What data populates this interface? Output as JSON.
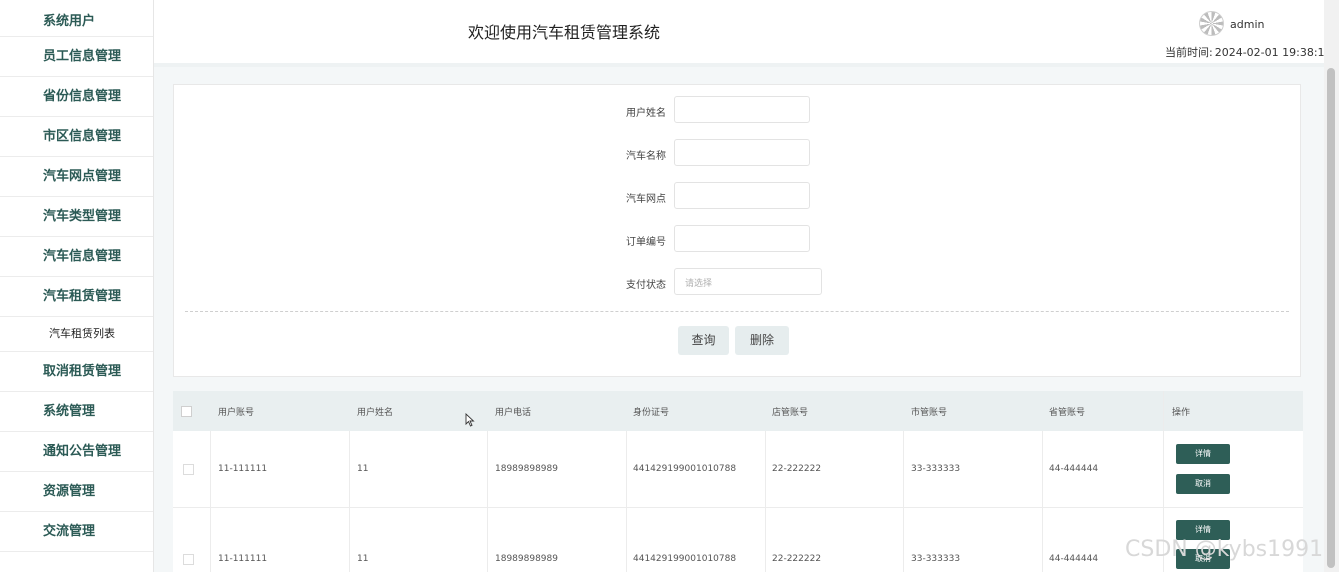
{
  "header": {
    "title": "欢迎使用汽车租赁管理系统",
    "username": "admin",
    "clock_label": "当前时间:",
    "clock_value": "2024-02-01 19:38:13"
  },
  "sidebar": {
    "items": [
      "系统用户",
      "员工信息管理",
      "省份信息管理",
      "市区信息管理",
      "汽车网点管理",
      "汽车类型管理",
      "汽车信息管理",
      "汽车租赁管理",
      "汽车租赁列表",
      "取消租赁管理",
      "系统管理",
      "通知公告管理",
      "资源管理",
      "交流管理"
    ]
  },
  "search": {
    "fields": [
      {
        "label": "用户姓名",
        "value": ""
      },
      {
        "label": "汽车名称",
        "value": ""
      },
      {
        "label": "汽车网点",
        "value": ""
      },
      {
        "label": "订单编号",
        "value": ""
      }
    ],
    "status_label": "支付状态",
    "status_placeholder": "请选择",
    "query_button": "查询",
    "delete_button": "删除"
  },
  "table": {
    "headers": [
      "用户账号",
      "用户姓名",
      "用户电话",
      "身份证号",
      "店管账号",
      "市管账号",
      "省管账号",
      "操作"
    ],
    "rows": [
      [
        "11-111111",
        "11",
        "18989898989",
        "441429199001010788",
        "22-222222",
        "33-333333",
        "44-444444"
      ],
      [
        "11-111111",
        "11",
        "18989898989",
        "441429199001010788",
        "22-222222",
        "33-333333",
        "44-444444"
      ]
    ],
    "detail_button": "详情",
    "cancel_button": "取消"
  },
  "watermark": "CSDN @kybs1991"
}
